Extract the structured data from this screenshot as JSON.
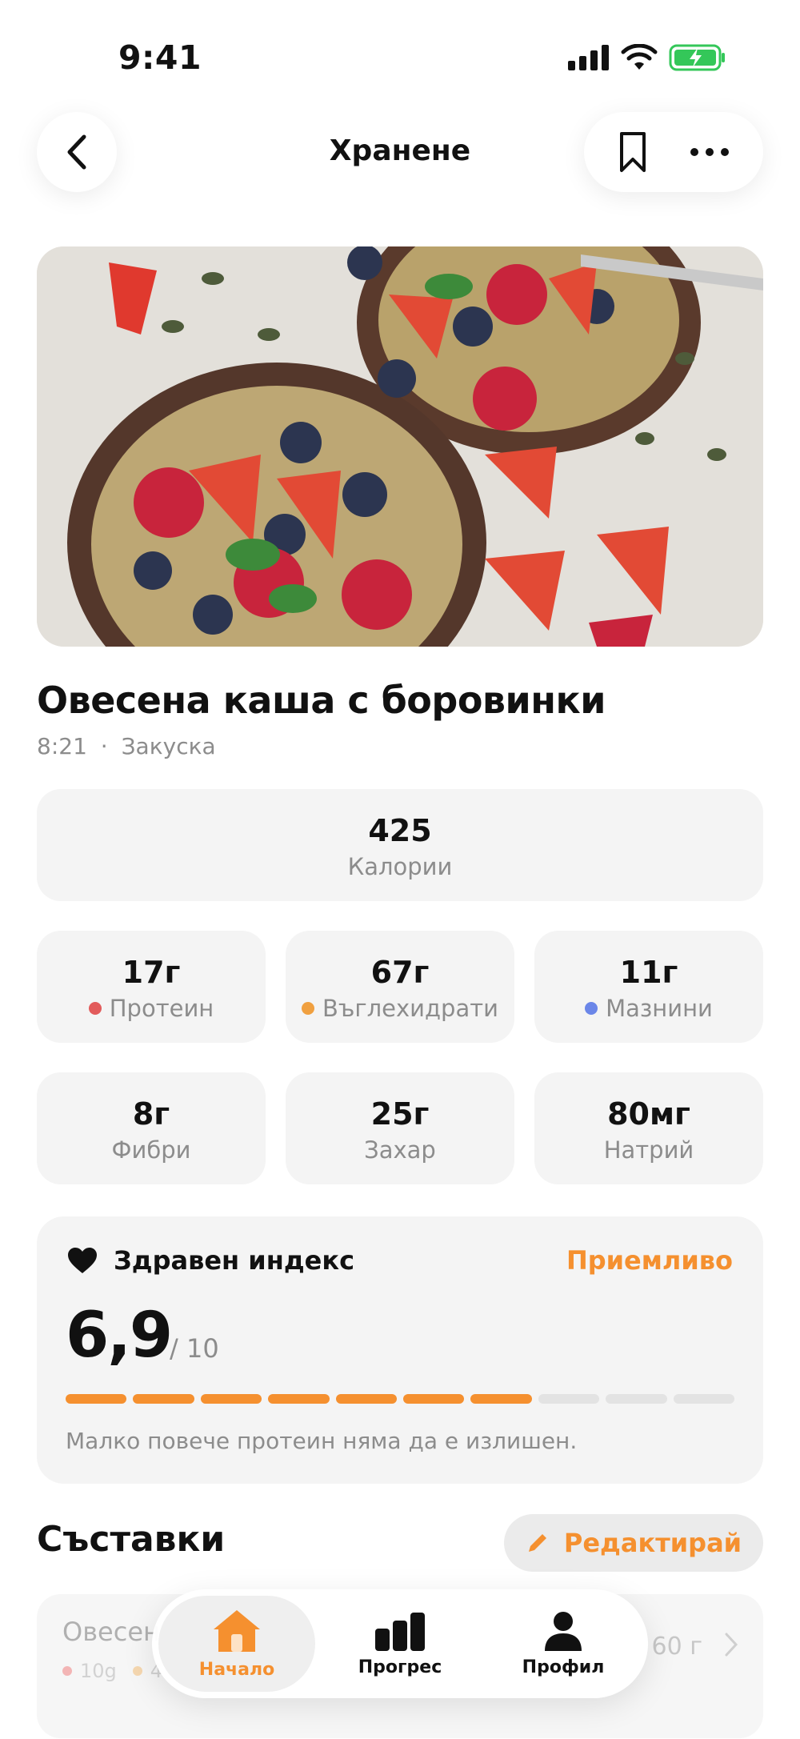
{
  "status_bar": {
    "time": "9:41"
  },
  "header": {
    "title": "Хранене"
  },
  "meal": {
    "title": "Овесена каша с боровинки",
    "time": "8:21",
    "separator": "·",
    "type": "Закуска"
  },
  "calories": {
    "value": "425",
    "label": "Калории"
  },
  "macros": [
    {
      "value": "17г",
      "label": "Протеин",
      "color": "#e25b5b"
    },
    {
      "value": "67г",
      "label": "Въглехидрати",
      "color": "#f0a040"
    },
    {
      "value": "11г",
      "label": "Мазнини",
      "color": "#6b86e8"
    }
  ],
  "nutrients": [
    {
      "value": "8г",
      "label": "Фибри"
    },
    {
      "value": "25г",
      "label": "Захар"
    },
    {
      "value": "80мг",
      "label": "Натрий"
    }
  ],
  "health": {
    "title": "Здравен индекс",
    "status": "Приемливо",
    "score": "6,9",
    "max": "/ 10",
    "filled_segments": 7,
    "total_segments": 10,
    "note": "Малко повече протеин няма да е излишен.",
    "accent": "#f5902f"
  },
  "ingredients": {
    "title": "Съставки",
    "edit_label": "Редактирай",
    "items": [
      {
        "name": "Овесени",
        "protein": "10g",
        "carbs": "4",
        "qty": "60 г"
      }
    ]
  },
  "tabbar": {
    "tabs": [
      {
        "label": "Начало",
        "icon": "home-icon",
        "active": true
      },
      {
        "label": "Прогрес",
        "icon": "bar-chart-icon",
        "active": false
      },
      {
        "label": "Профил",
        "icon": "profile-icon",
        "active": false
      }
    ]
  }
}
